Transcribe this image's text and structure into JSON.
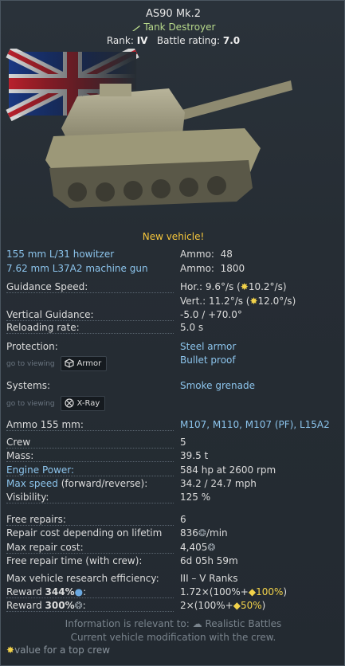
{
  "header": {
    "name": "AS90 Mk.2",
    "type": "Tank Destroyer",
    "rank_label": "Rank:",
    "rank_value": "IV",
    "br_label": "Battle rating:",
    "br_value": "7.0"
  },
  "new_vehicle": "New vehicle!",
  "weapons": [
    {
      "name": "155 mm L/31 howitzer",
      "ammo_label": "Ammo:",
      "ammo": "48"
    },
    {
      "name": "7.62 mm L37A2 machine gun",
      "ammo_label": "Ammo:",
      "ammo": "1800"
    }
  ],
  "guidance_speed": {
    "label": "Guidance Speed:",
    "hor": "Hor.: 9.6°/s (",
    "hor_top": "10.2°/s",
    "ver": "Vert.: 11.2°/s (",
    "ver_top": "12.0°/s"
  },
  "vertical_guidance": {
    "label": "Vertical Guidance:",
    "value": "-5.0 / +70.0°"
  },
  "reloading": {
    "label": "Reloading rate:",
    "value": "5.0 s"
  },
  "protection": {
    "label": "Protection:",
    "v1": "Steel armor",
    "v2": "Bullet proof"
  },
  "armor_view": {
    "hint": "go to viewing",
    "button": "Armor"
  },
  "systems": {
    "label": "Systems:",
    "value": "Smoke grenade"
  },
  "xray_view": {
    "hint": "go to viewing",
    "button": "X-Ray"
  },
  "ammo155": {
    "label": "Ammo 155 mm:",
    "value": "M107, M110, M107 (PF), L15A2"
  },
  "crew": {
    "label": "Crew",
    "value": "5"
  },
  "mass": {
    "label": "Mass:",
    "value": "39.5 t"
  },
  "engine": {
    "label": "Engine Power:",
    "value": "584 hp at 2600 rpm"
  },
  "speed": {
    "label_blue": "Max speed",
    "label_rest": " (forward/reverse):",
    "value": "34.2 / 24.7 mph"
  },
  "visibility": {
    "label": "Visibility:",
    "value": "125 %"
  },
  "free_repairs": {
    "label": "Free repairs:",
    "value": "6"
  },
  "repair_cost": {
    "label": "Repair cost depending on lifetim",
    "value": "836",
    "unit": "/min"
  },
  "max_repair": {
    "label": "Max repair cost:",
    "value": "4,405"
  },
  "free_repair_time": {
    "label": "Free repair time (with crew):",
    "value": "6d 05h 59m"
  },
  "research_eff": {
    "label": "Max vehicle research efficiency:",
    "value": "III – V Ranks"
  },
  "reward_rp": {
    "label": "Reward ",
    "pct": "344%",
    "colon": ":",
    "value": "1.72×(100%+",
    "bonus": "100%",
    "close": ")"
  },
  "reward_sl": {
    "label": "Reward ",
    "pct": "300%",
    "colon": ":",
    "value": "2×(100%+",
    "bonus": "50%",
    "close": ")"
  },
  "footer": {
    "line1_a": "Information is relevant to: ",
    "line1_b": "Realistic Battles",
    "line2": "Current vehicle modification with the crew.",
    "topcrew": "value for a top crew"
  },
  "colors": {
    "accent_blue": "#8cc4ec",
    "gold": "#f2d24a",
    "new_vehicle": "#f5c63c",
    "type_green": "#b7d98b"
  }
}
